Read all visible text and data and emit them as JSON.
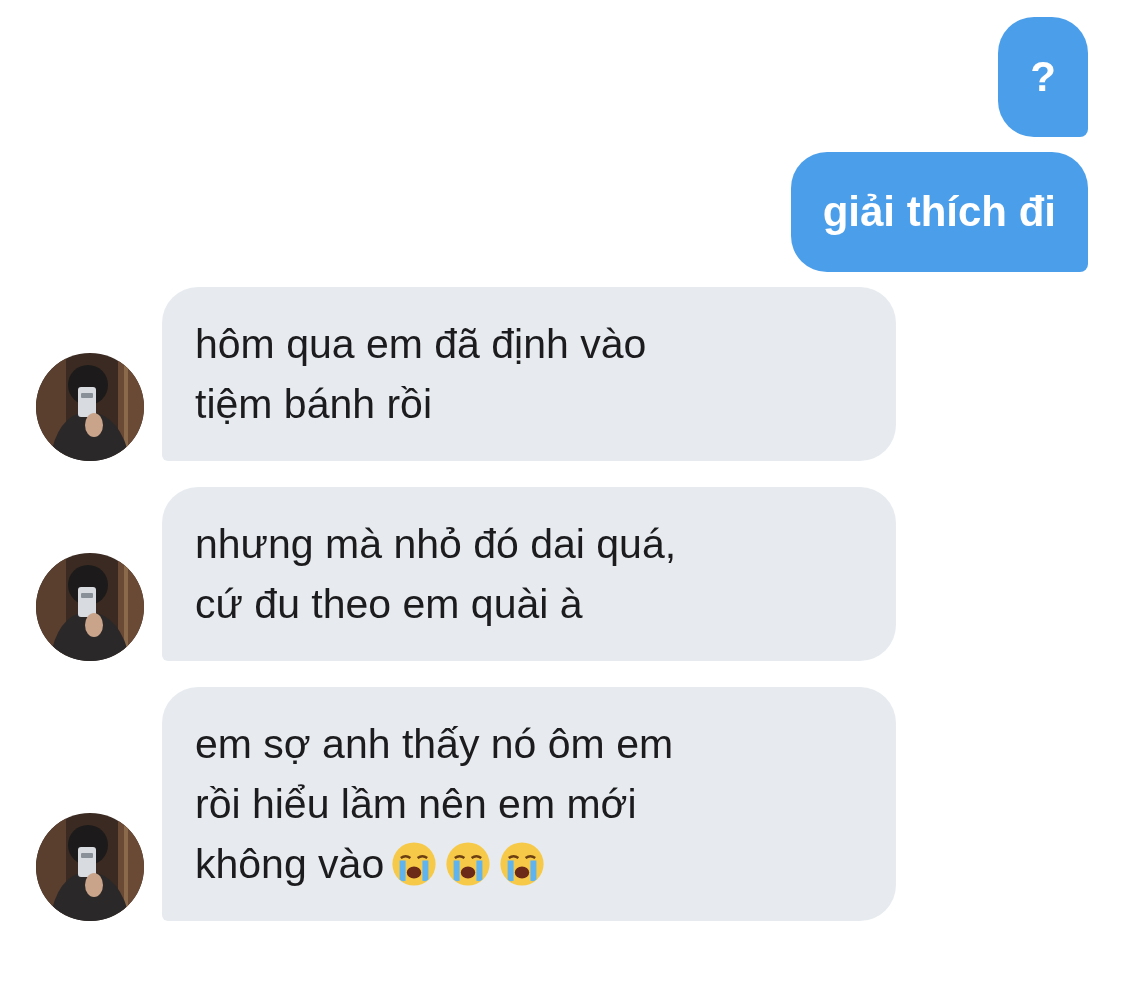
{
  "messages": [
    {
      "kind": "sent",
      "lines": [
        "?"
      ]
    },
    {
      "kind": "sent",
      "lines": [
        "giải thích đi"
      ]
    },
    {
      "kind": "received",
      "lines": [
        "hôm qua em đã định vào",
        "tiệm bánh rồi"
      ],
      "avatar": {
        "kind": "picture"
      }
    },
    {
      "kind": "received",
      "lines": [
        "nhưng mà nhỏ đó dai quá,",
        "cứ đu theo em quài à"
      ],
      "avatar": {
        "kind": "picture"
      }
    },
    {
      "kind": "received",
      "lines": [
        "em sợ anh thấy nó ôm em",
        "rồi hiểu lầm nên em mới",
        "không vào"
      ],
      "emojis": [
        {
          "kind": "crying-face"
        },
        {
          "kind": "crying-face"
        },
        {
          "kind": "crying-face"
        }
      ],
      "avatar": {
        "kind": "picture"
      }
    }
  ]
}
